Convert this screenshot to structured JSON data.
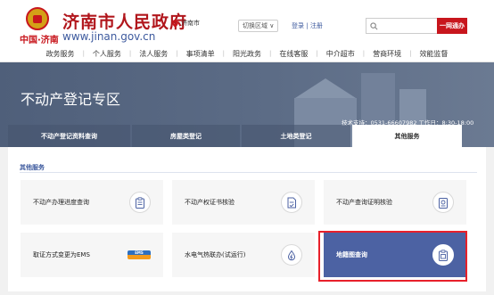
{
  "header": {
    "site_title": "济南市人民政府",
    "site_sub": "中国·济南",
    "site_url": "www.jinan.gov.cn",
    "location": "济南市",
    "switch_region": "切换区域 ∨",
    "login": "登录",
    "register": "注册",
    "auth_separator": "|",
    "search_placeholder": "",
    "onego_label": "一网通办"
  },
  "nav": {
    "items": [
      "政务服务",
      "个人服务",
      "法人服务",
      "事项清单",
      "阳光政务",
      "在线客服",
      "中介超市",
      "营商环境",
      "效能监督"
    ]
  },
  "banner": {
    "title": "不动产登记专区",
    "support": "技术支持：0531-66607982 工作日：8:30-18:00"
  },
  "tabs": [
    {
      "label": "不动产登记资料查询",
      "active": false
    },
    {
      "label": "房屋类登记",
      "active": false
    },
    {
      "label": "土地类登记",
      "active": false
    },
    {
      "label": "其他服务",
      "active": true
    }
  ],
  "section": {
    "title": "其他服务"
  },
  "cards": [
    {
      "label": "不动产办理进度查询",
      "icon": "clipboard-icon"
    },
    {
      "label": "不动产权证书核验",
      "icon": "document-icon"
    },
    {
      "label": "不动产查询证明核验",
      "icon": "certificate-icon"
    },
    {
      "label": "取证方式变更为EMS",
      "icon": "ems-logo",
      "ems_text": "EMS"
    },
    {
      "label": "水电气热联办(试运行)",
      "icon": "utilities-icon"
    },
    {
      "label": "地籍图查询",
      "icon": "map-icon",
      "highlight": true
    }
  ],
  "colors": {
    "brand_red": "#c8161d",
    "accent_blue": "#4c62a3",
    "selection_border": "#e8202a"
  }
}
